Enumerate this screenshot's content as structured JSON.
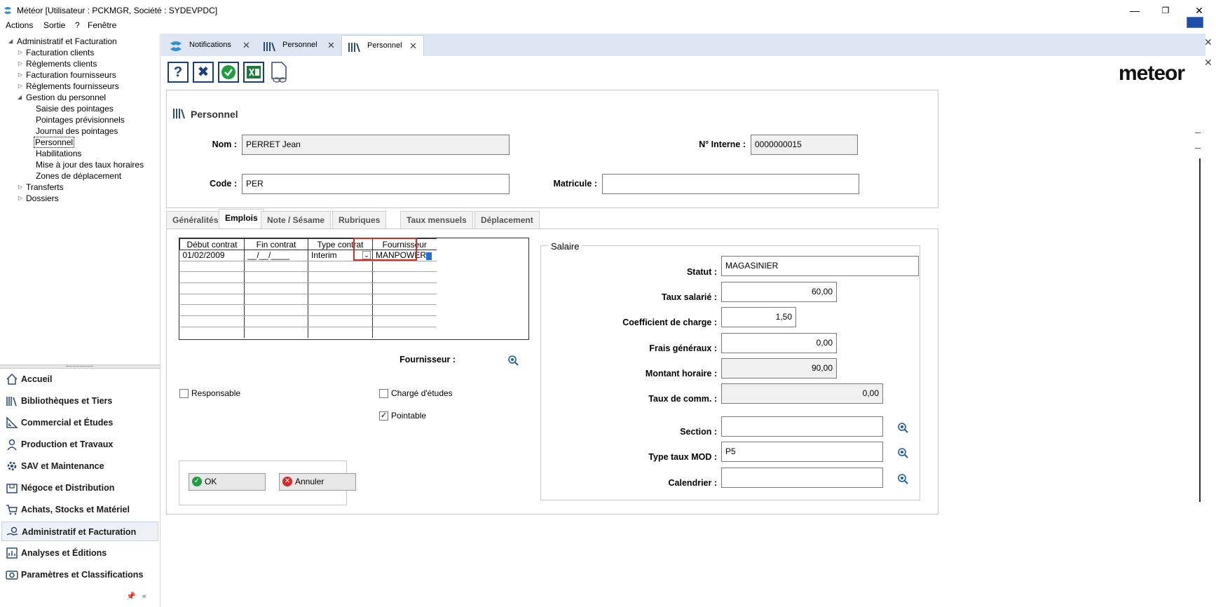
{
  "window": {
    "title": "Météor [Utilisateur : PCKMGR, Société : SYDEVPDC]"
  },
  "menu": [
    "Actions",
    "Sortie",
    "?",
    "Fenêtre"
  ],
  "tree": {
    "root": "Administratif et Facturation",
    "items": [
      {
        "label": "Facturation clients",
        "level": 1,
        "expander": "closed"
      },
      {
        "label": "Règlements clients",
        "level": 1,
        "expander": "closed"
      },
      {
        "label": "Facturation fournisseurs",
        "level": 1,
        "expander": "closed"
      },
      {
        "label": "Règlements fournisseurs",
        "level": 1,
        "expander": "closed"
      },
      {
        "label": "Gestion du personnel",
        "level": 1,
        "expander": "open"
      },
      {
        "label": "Saisie des pointages",
        "level": 2
      },
      {
        "label": "Pointages prévisionnels",
        "level": 2
      },
      {
        "label": "Journal des pointages",
        "level": 2
      },
      {
        "label": "Personnel",
        "level": 2,
        "selected": true
      },
      {
        "label": "Habilitations",
        "level": 2
      },
      {
        "label": "Mise à jour des taux horaires",
        "level": 2
      },
      {
        "label": "Zones de déplacement",
        "level": 2
      },
      {
        "label": "Transferts",
        "level": 1,
        "expander": "closed"
      },
      {
        "label": "Dossiers",
        "level": 1,
        "expander": "closed"
      }
    ]
  },
  "nav": [
    {
      "label": "Accueil",
      "icon": "home-icon"
    },
    {
      "label": "Bibliothèques et Tiers",
      "icon": "books-icon"
    },
    {
      "label": "Commercial et Études",
      "icon": "ruler-icon"
    },
    {
      "label": "Production et Travaux",
      "icon": "worker-icon"
    },
    {
      "label": "SAV et Maintenance",
      "icon": "gear-icon"
    },
    {
      "label": "Négoce et Distribution",
      "icon": "box-icon"
    },
    {
      "label": "Achats, Stocks et Matériel",
      "icon": "cart-icon"
    },
    {
      "label": "Administratif et Facturation",
      "icon": "hand-coin-icon",
      "active": true
    },
    {
      "label": "Analyses et Éditions",
      "icon": "report-icon"
    },
    {
      "label": "Paramètres et Classifications",
      "icon": "settings-icon"
    }
  ],
  "tabs": [
    {
      "label": "Notifications"
    },
    {
      "label": "Personnel"
    },
    {
      "label": "Personnel",
      "active": true
    }
  ],
  "logo": "meteor",
  "header": {
    "title": "Personnel",
    "nom_label": "Nom :",
    "nom_value": "PERRET Jean",
    "interne_label": "N° Interne :",
    "interne_value": "0000000015",
    "code_label": "Code :",
    "code_value": "PER",
    "matricule_label": "Matricule :",
    "matricule_value": ""
  },
  "form_tabs": [
    {
      "label": "Généralités"
    },
    {
      "label": "Emplois",
      "active": true
    },
    {
      "label": "Note / Sésame"
    },
    {
      "label": "Rubriques"
    },
    {
      "label": "Taux mensuels"
    },
    {
      "label": "Déplacement"
    }
  ],
  "grid": {
    "columns": [
      "Début contrat",
      "Fin contrat",
      "Type contrat",
      "Fournisseur"
    ],
    "rows": [
      {
        "debut": "01/02/2009",
        "fin": "__/__/____",
        "type": "Interim",
        "fournisseur": "MANPOWER"
      }
    ]
  },
  "fournisseur_label": "Fournisseur :",
  "checkboxes": {
    "responsable": {
      "label": "Responsable",
      "checked": false
    },
    "charge_etudes": {
      "label": "Chargé d'études",
      "checked": false
    },
    "pointable": {
      "label": "Pointable",
      "checked": true
    }
  },
  "buttons": {
    "ok": "OK",
    "annuler": "Annuler"
  },
  "salaire": {
    "legend": "Salaire",
    "statut_label": "Statut :",
    "statut_value": "MAGASINIER",
    "taux_salarie_label": "Taux salarié :",
    "taux_salarie_value": "60,00",
    "coef_label": "Coefficient de charge :",
    "coef_value": "1,50",
    "frais_label": "Frais généraux :",
    "frais_value": "0,00",
    "montant_label": "Montant horaire :",
    "montant_value": "90,00",
    "comm_label": "Taux de comm. :",
    "comm_value": "0,00",
    "section_label": "Section :",
    "section_value": "",
    "mod_label": "Type taux MOD :",
    "mod_value": "P5",
    "calendrier_label": "Calendrier :",
    "calendrier_value": ""
  },
  "colors": {
    "tabstrip": "#dde6f2",
    "highlight": "#d62a2a",
    "accent": "#1e6fd9"
  }
}
